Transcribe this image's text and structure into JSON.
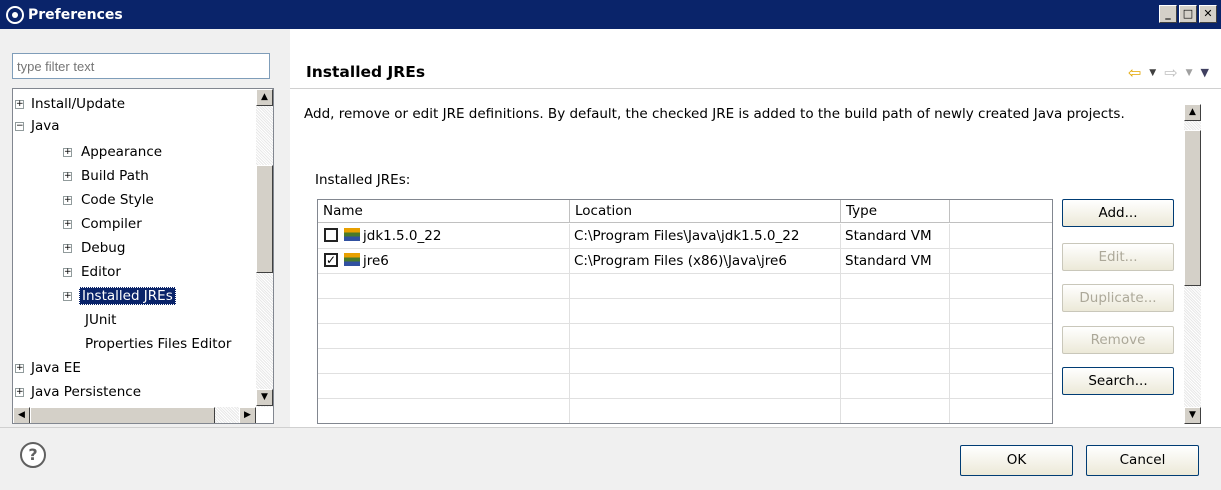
{
  "window": {
    "title": "Preferences",
    "controls": [
      "_",
      "□",
      "✕"
    ]
  },
  "filter": {
    "placeholder": "type filter text"
  },
  "tree": {
    "items": [
      {
        "label": "Install/Update",
        "expander": "+"
      },
      {
        "label": "Java",
        "expander": "−"
      },
      {
        "label": "Appearance",
        "expander": "+"
      },
      {
        "label": "Build Path",
        "expander": "+"
      },
      {
        "label": "Code Style",
        "expander": "+"
      },
      {
        "label": "Compiler",
        "expander": "+"
      },
      {
        "label": "Debug",
        "expander": "+"
      },
      {
        "label": "Editor",
        "expander": "+"
      },
      {
        "label": "Installed JREs",
        "expander": "+",
        "selected": true
      },
      {
        "label": "JUnit",
        "expander": ""
      },
      {
        "label": "Properties Files Editor",
        "expander": ""
      },
      {
        "label": "Java EE",
        "expander": "+"
      },
      {
        "label": "Java Persistence",
        "expander": "+"
      }
    ]
  },
  "page": {
    "title": "Installed JREs",
    "description": "Add, remove or edit JRE definitions. By default, the checked JRE is added to the build path of newly created Java projects.",
    "table_label": "Installed JREs:"
  },
  "table": {
    "columns": [
      "Name",
      "Location",
      "Type",
      ""
    ],
    "rows": [
      {
        "checked": false,
        "name": "jdk1.5.0_22",
        "location": "C:\\Program Files\\Java\\jdk1.5.0_22",
        "type": "Standard VM"
      },
      {
        "checked": true,
        "name": "jre6",
        "location": "C:\\Program Files (x86)\\Java\\jre6",
        "type": "Standard VM"
      }
    ]
  },
  "buttons": {
    "add": "Add...",
    "edit": "Edit...",
    "duplicate": "Duplicate...",
    "remove": "Remove",
    "search": "Search..."
  },
  "footer": {
    "ok": "OK",
    "cancel": "Cancel",
    "help": "?"
  },
  "colors": {
    "titlebar": "#0a246a",
    "selection": "#0a246a",
    "nav_arrow": "#e3a600"
  }
}
